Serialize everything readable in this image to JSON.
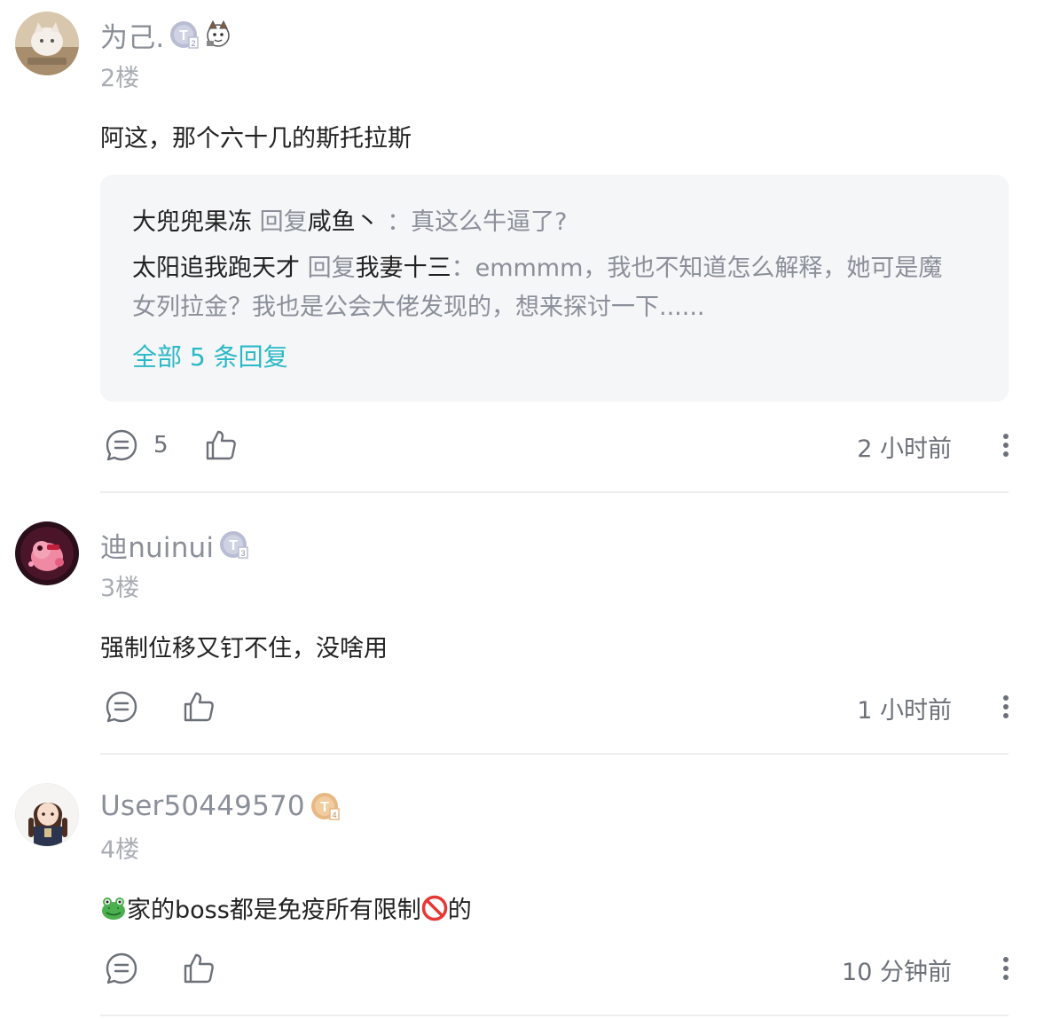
{
  "comments": [
    {
      "username": "为己.",
      "badge_level": "T2",
      "floor": "2楼",
      "content": "阿这，那个六十几的斯托拉斯",
      "replies": [
        {
          "author": "大兜兜果冻",
          "verb": "回复",
          "target": "咸鱼丶",
          "text": "：真这么牛逼了?"
        },
        {
          "author": "太阳追我跑天才",
          "verb": "回复",
          "target": "我妻十三",
          "text": "：emmmm，我也不知道怎么解释，她可是魔",
          "text_cont": "女列拉金？我也是公会大佬发现的，想来探讨一下......"
        }
      ],
      "view_all": "全部 5 条回复",
      "reply_count": "5",
      "time": "2 小时前"
    },
    {
      "username": "迪nuinui",
      "badge_level": "T3",
      "floor": "3楼",
      "content": "强制位移又钉不住，没啥用",
      "time": "1 小时前"
    },
    {
      "username": "User50449570",
      "badge_level": "T4",
      "floor": "4楼",
      "content_pre": "家的boss都是免疫所有限制",
      "content_post": "的",
      "emoji_1": "frog-emoji",
      "emoji_2": "prohibited-emoji",
      "time": "10 分钟前"
    }
  ],
  "colors": {
    "accent": "#2bb8c6",
    "muted_text": "#8a8f99",
    "body_text": "#222222",
    "reply_bg": "#f5f6f8",
    "badge_silver": "#b9bdd3",
    "badge_gold": "#e8b884"
  },
  "icons": {
    "comment": "comment-bubble-icon",
    "like": "thumbs-up-icon",
    "more": "more-vertical-icon"
  }
}
